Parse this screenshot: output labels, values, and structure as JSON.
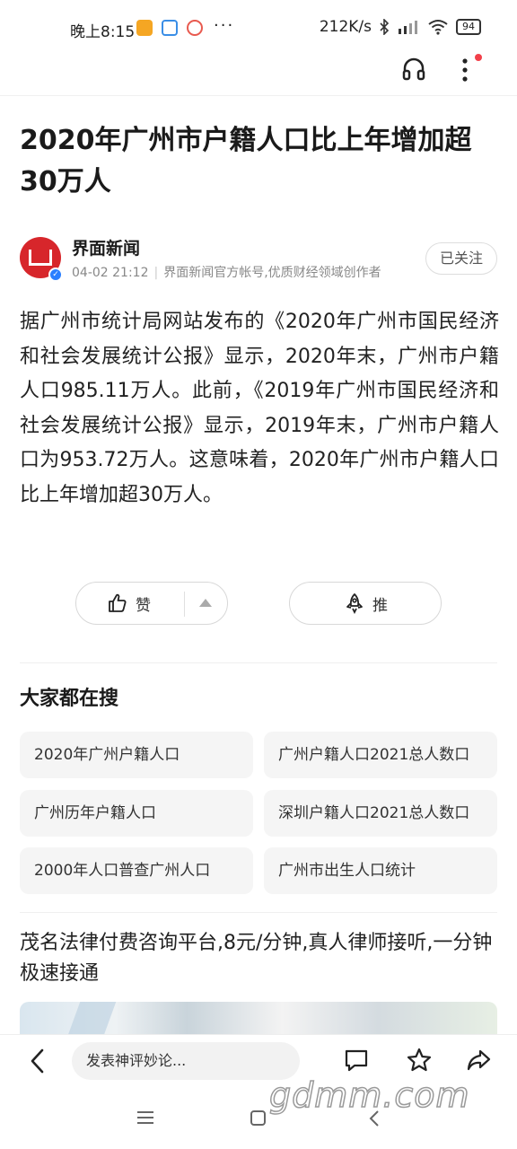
{
  "status_bar": {
    "time": "晚上8:15",
    "more": "···",
    "network_speed": "212K/s",
    "battery": "94"
  },
  "article": {
    "title": "2020年广州市户籍人口比上年增加超30万人",
    "author": {
      "name": "界面新闻",
      "date": "04-02 21:12",
      "description": "界面新闻官方帐号,优质财经领域创作者",
      "follow_label": "已关注"
    },
    "body": "据广州市统计局网站发布的《2020年广州市国民经济和社会发展统计公报》显示，2020年末，广州市户籍人口985.11万人。此前，《2019年广州市国民经济和社会发展统计公报》显示，2019年末，广州市户籍人口为953.72万人。这意味着，2020年广州市户籍人口比上年增加超30万人。",
    "like_label": "赞",
    "push_label": "推"
  },
  "search_section": {
    "title": "大家都在搜",
    "items": [
      "2020年广州户籍人口",
      "广州户籍人口2021总人数口",
      "广州历年户籍人口",
      "深圳户籍人口2021总人数口",
      "2000年人口普查广州人口",
      "广州市出生人口统计"
    ]
  },
  "ad": {
    "title": "茂名法律付费咨询平台,8元/分钟,真人律师接听,一分钟极速接通"
  },
  "bottom_bar": {
    "comment_placeholder": "发表神评妙论..."
  },
  "watermark": "gdmm.com",
  "colors": {
    "brand_red": "#d7262b",
    "verify_blue": "#2a7fff",
    "notification_dot": "#f2404a"
  },
  "icons": [
    "headphones-icon",
    "more-vertical-icon",
    "thumbs-up-icon",
    "rocket-icon",
    "back-arrow-icon",
    "comment-icon",
    "star-icon",
    "share-icon"
  ]
}
